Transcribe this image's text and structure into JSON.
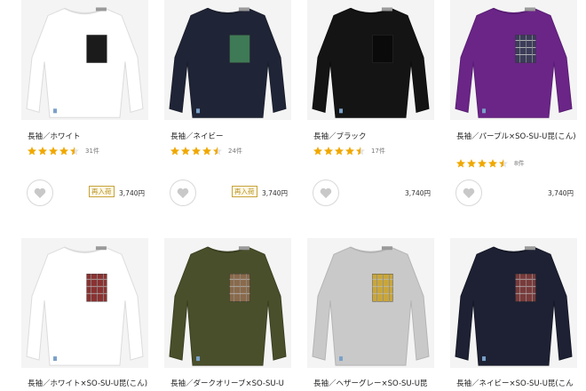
{
  "products": [
    {
      "title": "長袖／ホワイト",
      "reviews": "31件",
      "rating": 4.5,
      "restock": "再入荷",
      "price": "3,740円",
      "shirt": "#ffffff",
      "pocket": "#1b1b1b",
      "stroke": "#dcdcdc"
    },
    {
      "title": "長袖／ネイビー",
      "reviews": "24件",
      "rating": 4.5,
      "restock": "再入荷",
      "price": "3,740円",
      "shirt": "#1f2436",
      "pocket": "#3e7a55",
      "stroke": "#1a1e2c"
    },
    {
      "title": "長袖／ブラック",
      "reviews": "17件",
      "rating": 4.5,
      "restock": "",
      "price": "3,740円",
      "shirt": "#141414",
      "pocket": "#0a0a0a",
      "stroke": "#0d0d0d"
    },
    {
      "title": "長袖／パープル×SO-SU-U昆(こん)",
      "reviews": "8件",
      "rating": 4.5,
      "restock": "",
      "price": "3,740円",
      "shirt": "#6a2587",
      "pocket": "#3c3c5a",
      "stroke": "#5a1d74"
    },
    {
      "title": "長袖／ホワイト×SO-SU-U昆(こん)",
      "shirt": "#ffffff",
      "pocket": "#8a3232",
      "stroke": "#dcdcdc"
    },
    {
      "title": "長袖／ダークオリーブ×SO-SU-U",
      "shirt": "#4a4f2b",
      "pocket": "#8a6a4a",
      "stroke": "#3a3f20"
    },
    {
      "title": "長袖／ヘザーグレー×SO-SU-U昆",
      "shirt": "#c9c9c9",
      "pocket": "#c9a63a",
      "stroke": "#b4b4b4"
    },
    {
      "title": "長袖／ネイビー×SO-SU-U昆(こん",
      "shirt": "#1d2133",
      "pocket": "#7a3a3a",
      "stroke": "#151827"
    }
  ],
  "colors": {
    "star": "#f0a800",
    "star_empty": "#e3e3e3"
  },
  "icons": {
    "heart": "heart-icon",
    "star": "star-icon"
  }
}
